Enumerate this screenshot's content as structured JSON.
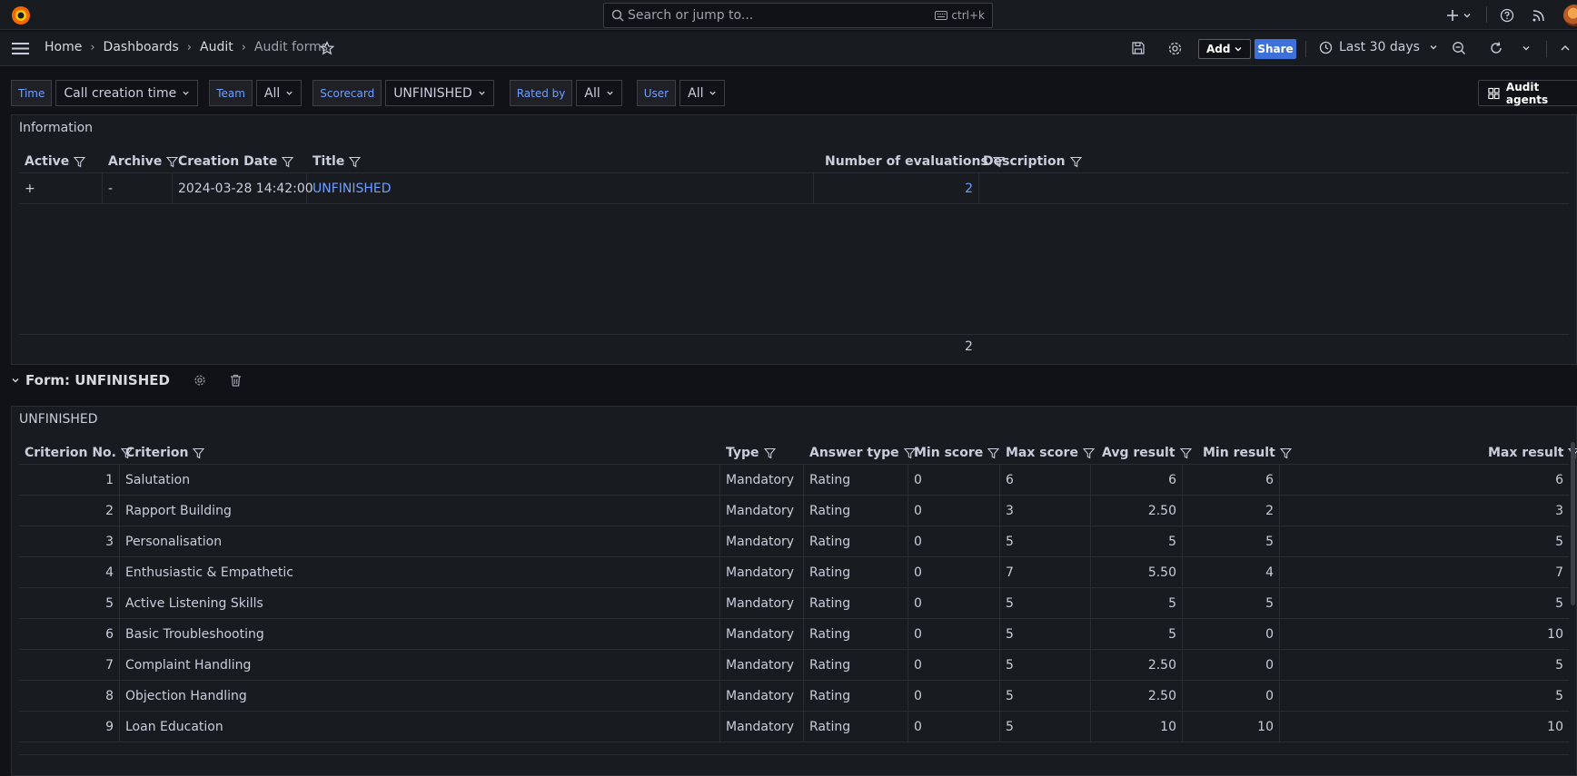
{
  "topbar": {
    "search_placeholder": "Search or jump to...",
    "search_shortcut": "ctrl+k"
  },
  "breadcrumbs": [
    "Home",
    "Dashboards",
    "Audit",
    "Audit forms"
  ],
  "toolbar": {
    "add_label": "Add",
    "share_label": "Share",
    "time_range": "Last 30 days"
  },
  "variables": [
    {
      "label": "Time",
      "value": "Call creation time"
    },
    {
      "label": "Team",
      "value": "All"
    },
    {
      "label": "Scorecard",
      "value": "UNFINISHED"
    },
    {
      "label": "Rated by",
      "value": "All"
    },
    {
      "label": "User",
      "value": "All"
    }
  ],
  "audit_agents_label": "Audit agents",
  "info_panel": {
    "title": "Information",
    "columns": [
      "Active",
      "Archive",
      "Creation Date",
      "Title",
      "Number of evaluations",
      "Description"
    ],
    "row": {
      "active": "+",
      "archive": "-",
      "creation_date": "2024-03-28 14:42:00",
      "title": "UNFINISHED",
      "evaluations": "2",
      "description": ""
    },
    "footer_total": "2"
  },
  "row_header": {
    "title": "Form: UNFINISHED"
  },
  "form_panel": {
    "title": "UNFINISHED",
    "columns": [
      "Criterion No.",
      "Criterion",
      "Type",
      "Answer type",
      "Min score",
      "Max score",
      "Avg result",
      "Min result",
      "Max result"
    ],
    "rows": [
      {
        "no": "1",
        "criterion": "Salutation",
        "type": "Mandatory",
        "answer": "Rating",
        "min_score": "0",
        "max_score": "6",
        "avg": "6",
        "min_res": "6",
        "max_res": "6"
      },
      {
        "no": "2",
        "criterion": "Rapport Building",
        "type": "Mandatory",
        "answer": "Rating",
        "min_score": "0",
        "max_score": "3",
        "avg": "2.50",
        "min_res": "2",
        "max_res": "3"
      },
      {
        "no": "3",
        "criterion": "Personalisation",
        "type": "Mandatory",
        "answer": "Rating",
        "min_score": "0",
        "max_score": "5",
        "avg": "5",
        "min_res": "5",
        "max_res": "5"
      },
      {
        "no": "4",
        "criterion": "Enthusiastic & Empathetic",
        "type": "Mandatory",
        "answer": "Rating",
        "min_score": "0",
        "max_score": "7",
        "avg": "5.50",
        "min_res": "4",
        "max_res": "7"
      },
      {
        "no": "5",
        "criterion": "Active Listening Skills",
        "type": "Mandatory",
        "answer": "Rating",
        "min_score": "0",
        "max_score": "5",
        "avg": "5",
        "min_res": "5",
        "max_res": "5"
      },
      {
        "no": "6",
        "criterion": "Basic Troubleshooting",
        "type": "Mandatory",
        "answer": "Rating",
        "min_score": "0",
        "max_score": "5",
        "avg": "5",
        "min_res": "0",
        "max_res": "10"
      },
      {
        "no": "7",
        "criterion": "Complaint Handling",
        "type": "Mandatory",
        "answer": "Rating",
        "min_score": "0",
        "max_score": "5",
        "avg": "2.50",
        "min_res": "0",
        "max_res": "5"
      },
      {
        "no": "8",
        "criterion": "Objection Handling",
        "type": "Mandatory",
        "answer": "Rating",
        "min_score": "0",
        "max_score": "5",
        "avg": "2.50",
        "min_res": "0",
        "max_res": "5"
      },
      {
        "no": "9",
        "criterion": "Loan Education",
        "type": "Mandatory",
        "answer": "Rating",
        "min_score": "0",
        "max_score": "5",
        "avg": "10",
        "min_res": "10",
        "max_res": "10"
      }
    ]
  },
  "colors": {
    "background": "#111217",
    "panel": "#181b1f",
    "accent_blue": "#6e9fff",
    "share_button": "#3d71d9"
  }
}
